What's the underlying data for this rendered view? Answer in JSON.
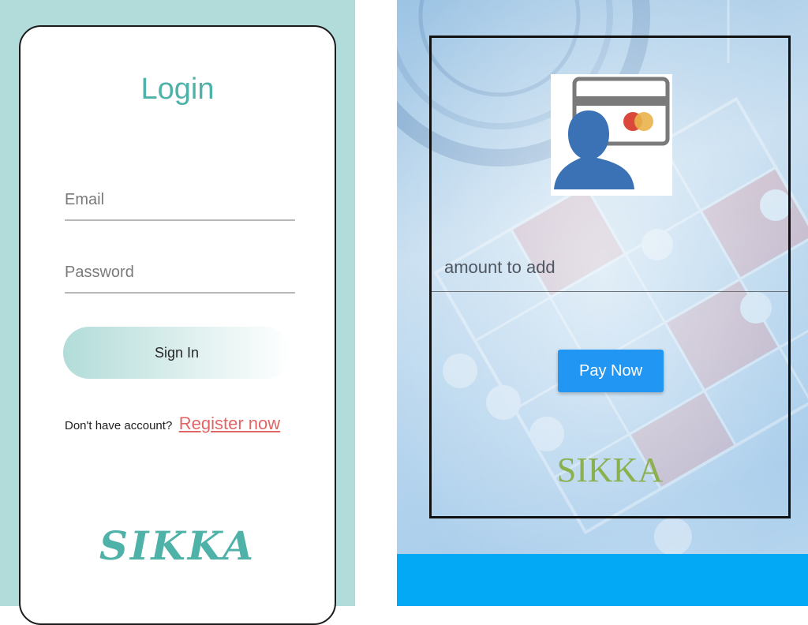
{
  "login": {
    "title": "Login",
    "email_placeholder": "Email",
    "password_placeholder": "Password",
    "signin_label": "Sign In",
    "register_prompt": "Don't have account?",
    "register_link": "Register now",
    "logo_text": "SIKKA"
  },
  "payment": {
    "amount_placeholder": "amount to add",
    "pay_button_label": "Pay Now",
    "logo_text": "SIKKA",
    "card_image_icon": "user-credit-card-icon"
  },
  "colors": {
    "left_background": "#b2dcd9",
    "teal_accent": "#4fb2a9",
    "register_link": "#e06666",
    "pay_button": "#2196f3",
    "bottom_bar": "#03a9f4",
    "right_logo": "#8bb04f"
  }
}
